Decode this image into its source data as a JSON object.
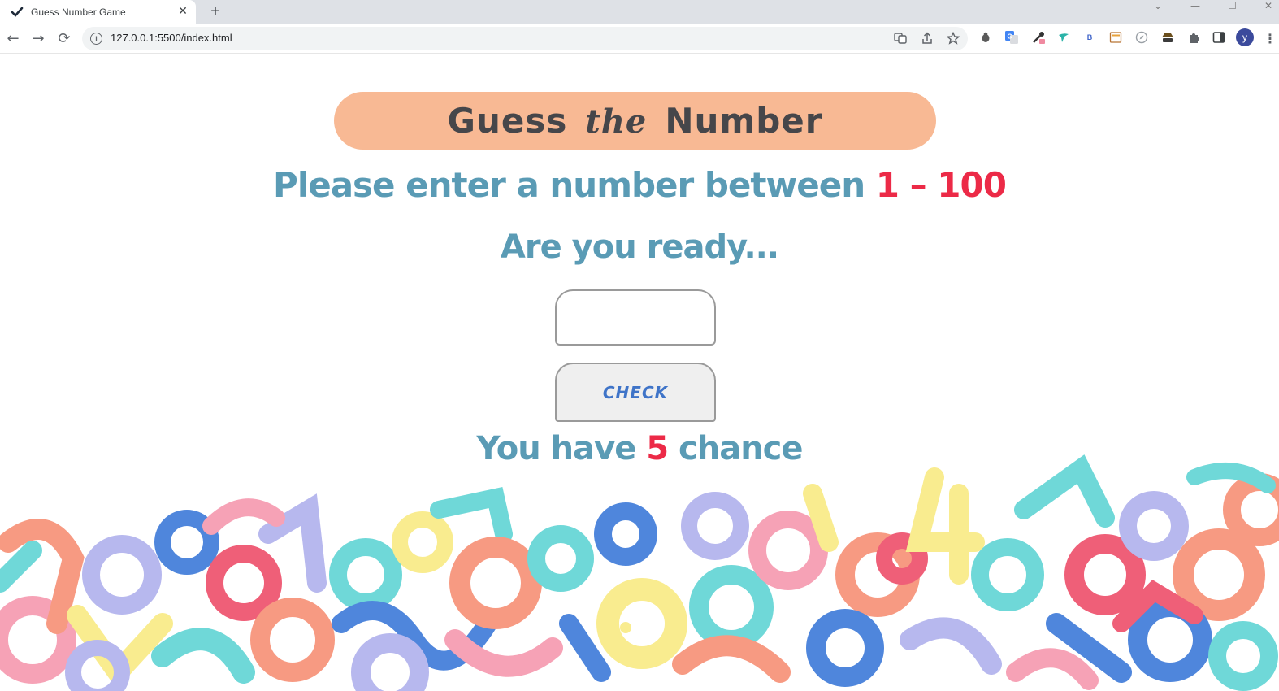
{
  "browser": {
    "tab": {
      "title": "Guess Number Game",
      "close_glyph": "✕",
      "favicon": "checkmark-icon"
    },
    "new_tab_glyph": "+",
    "window_controls": [
      "⌄",
      "—",
      "☐",
      "✕"
    ],
    "nav": {
      "back": "←",
      "forward": "→",
      "reload": "⟳"
    },
    "url": "127.0.0.1:5500/index.html",
    "info_glyph": "i",
    "profile_initial": "y"
  },
  "game": {
    "title_before": "Guess",
    "title_the": "the",
    "title_after": "Number",
    "prompt_text": "Please enter a number between ",
    "range_low": "1",
    "range_sep": " – ",
    "range_high": "100",
    "ready_text": "Are you ready...",
    "guess_value": "",
    "check_label": "CHECK",
    "chances_before": "You have ",
    "chances_count": "5",
    "chances_after": " chance"
  },
  "colors": {
    "banner": "#f8b994",
    "title_text": "#46464a",
    "text_blue": "#5a9bb5",
    "accent_red": "#ec2a47",
    "button_label": "#3f74c8"
  }
}
